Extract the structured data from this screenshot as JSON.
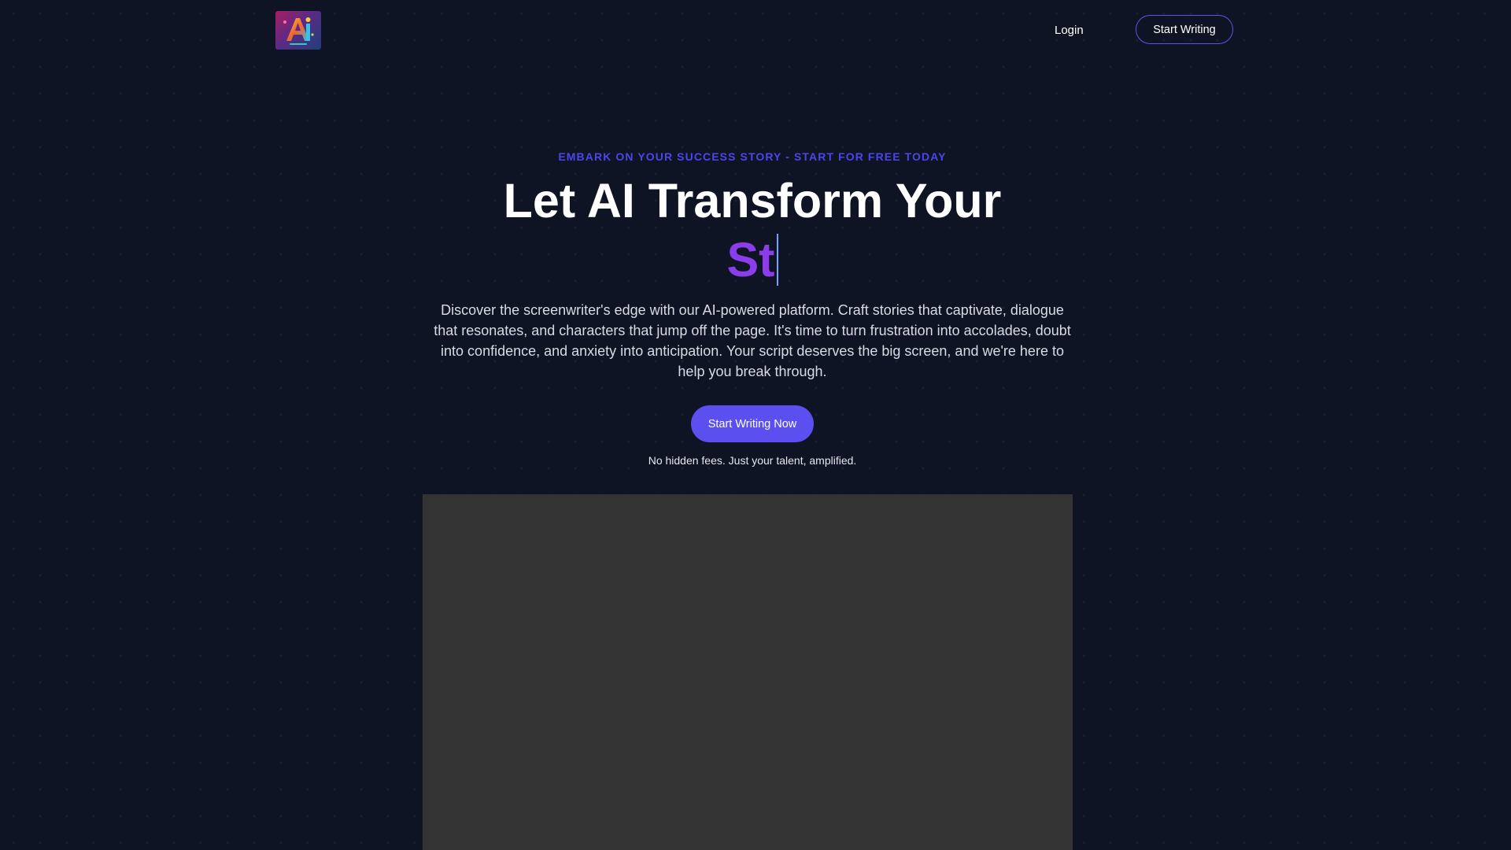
{
  "nav": {
    "logo_icon": "ai-letter-logo-icon",
    "login_label": "Login",
    "cta_label": "Start Writing"
  },
  "hero": {
    "eyebrow": "EMBARK ON YOUR SUCCESS STORY - START FOR FREE TODAY",
    "headline": "Let AI Transform Your",
    "typed_text": "St",
    "description": "Discover the screenwriter's edge with our AI-powered platform. Craft stories that captivate, dialogue that resonates, and characters that jump off the page. It's time to turn frustration into accolades, doubt into confidence, and anxiety into anticipation. Your script deserves the big screen, and we're here to help you break through.",
    "cta_label": "Start Writing Now",
    "note": "No hidden fees. Just your talent, amplified."
  },
  "colors": {
    "background": "#0f1424",
    "accent_blue": "#4b45ea",
    "accent_purple": "#8b3dea",
    "button": "#5b4ff0",
    "video_placeholder": "#333333"
  }
}
